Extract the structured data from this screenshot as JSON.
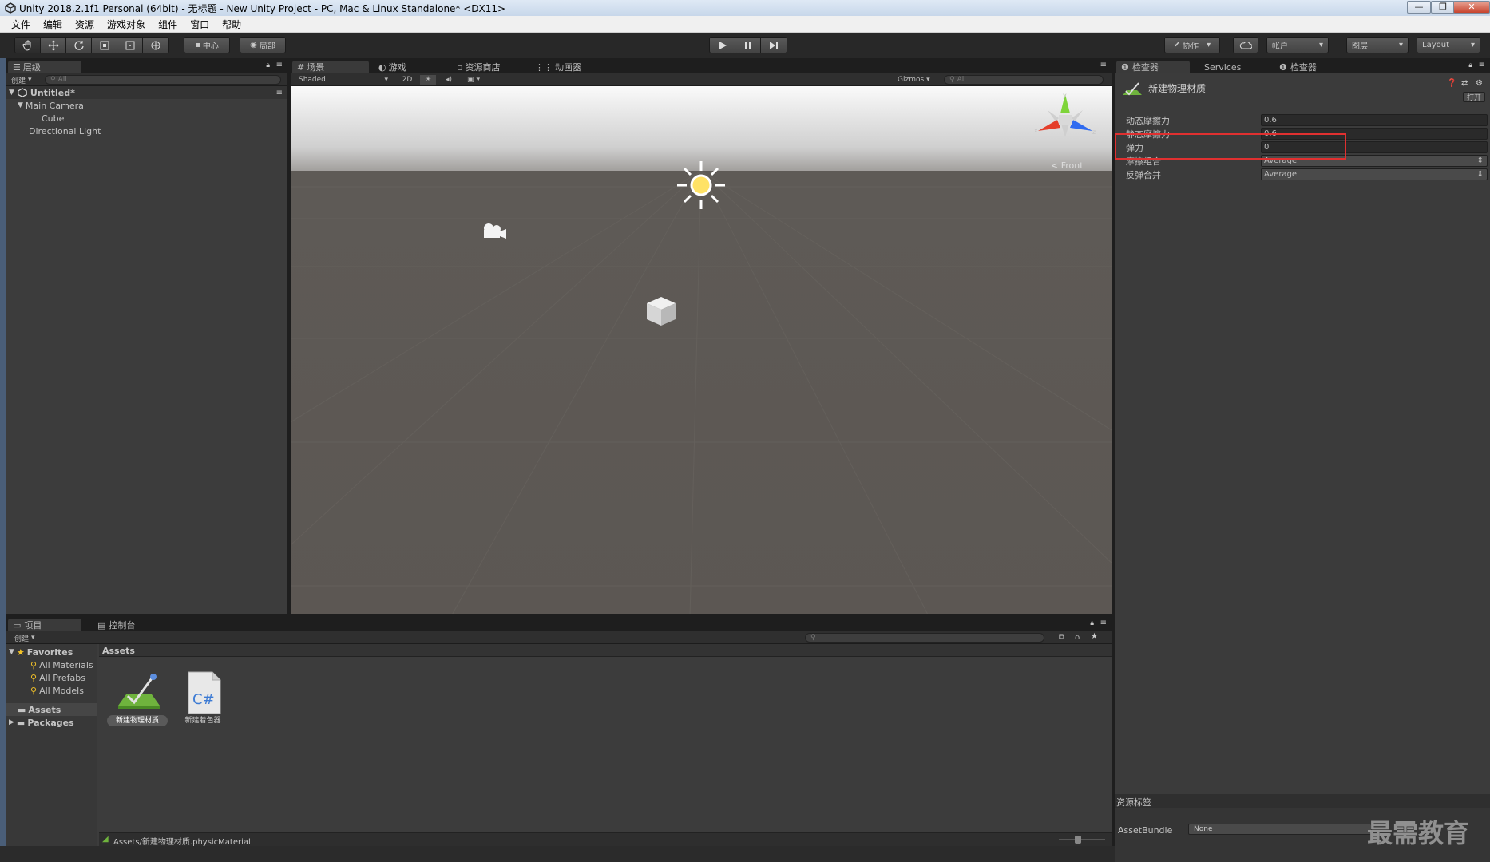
{
  "window": {
    "title": "Unity 2018.2.1f1 Personal (64bit) - 无标题 - New Unity Project - PC, Mac & Linux Standalone* <DX11>",
    "min": "—",
    "max": "❐",
    "close": "✕"
  },
  "menu": [
    "文件",
    "编辑",
    "资源",
    "游戏对象",
    "组件",
    "窗口",
    "帮助"
  ],
  "toolbar": {
    "pivot": "中心",
    "space": "局部",
    "collab": "协作",
    "account": "帐户",
    "layers": "图层",
    "layout": "Layout"
  },
  "hierarchy": {
    "tab": "层级",
    "create": "创建",
    "search_placeholder": "All",
    "scene": "Untitled*",
    "items": [
      "Main Camera",
      "Cube",
      "Directional Light"
    ]
  },
  "scene": {
    "tabs": [
      "场景",
      "游戏",
      "资源商店",
      "动画器"
    ],
    "shading": "Shaded",
    "mode_2d": "2D",
    "gizmos": "Gizmos",
    "search_placeholder": "All",
    "view_label": "Front",
    "axis_y": "y",
    "axis_x": "x",
    "axis_z": "z"
  },
  "inspector": {
    "tabs": [
      "检查器",
      "Services",
      "检查器"
    ],
    "asset_name": "新建物理材质",
    "open": "打开",
    "properties": [
      {
        "label": "动态摩擦力",
        "value": "0.6"
      },
      {
        "label": "静态摩擦力",
        "value": "0.6"
      },
      {
        "label": "弹力",
        "value": "0"
      },
      {
        "label": "摩擦组合",
        "value": "Average"
      },
      {
        "label": "反弹合并",
        "value": "Average"
      }
    ],
    "asset_labels": "资源标签",
    "assetbundle_label": "AssetBundle",
    "assetbundle_value": "None",
    "highlight_color": "#e03030"
  },
  "project": {
    "tabs": [
      "项目",
      "控制台"
    ],
    "create": "创建",
    "favorites": "Favorites",
    "favorite_items": [
      "All Materials",
      "All Prefabs",
      "All Models"
    ],
    "roots": [
      "Assets",
      "Packages"
    ],
    "breadcrumb": "Assets",
    "assets": [
      {
        "name": "新建物理材质",
        "type": "physic-material"
      },
      {
        "name": "新建着色器",
        "type": "csharp"
      }
    ],
    "csharp_glyph": "C#",
    "status_path": "Assets/新建物理材质.physicMaterial"
  },
  "watermark": "最需教育"
}
